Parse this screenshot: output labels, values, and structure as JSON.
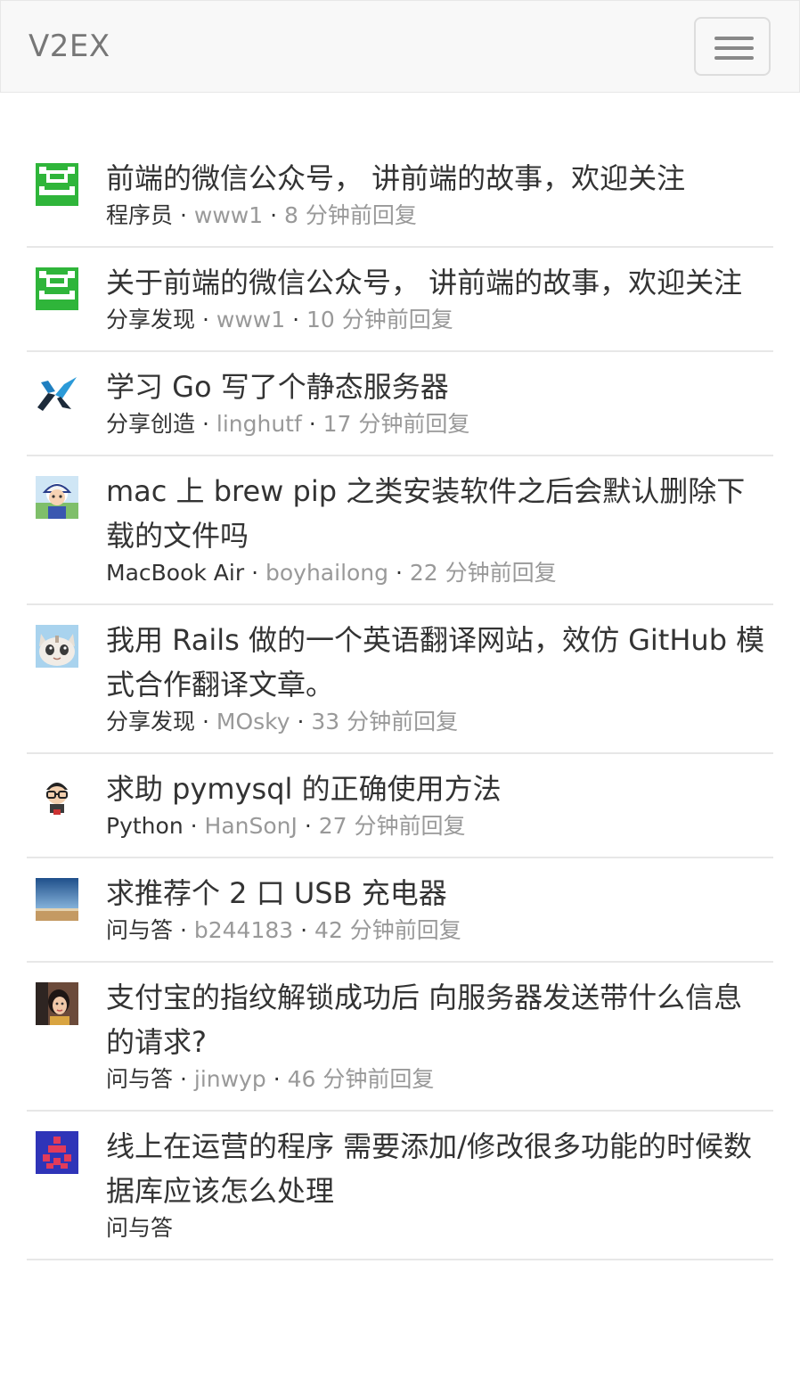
{
  "navbar": {
    "brand": "V2EX",
    "toggle_icon": "hamburger-menu-icon"
  },
  "topics": [
    {
      "title": "前端的微信公众号， 讲前端的故事，欢迎关注",
      "node": "程序员",
      "user": "www1",
      "time": "8 分钟前回复",
      "avatar_icon": "green-pixel-avatar-icon"
    },
    {
      "title": "关于前端的微信公众号， 讲前端的故事，欢迎关注",
      "node": "分享发现",
      "user": "www1",
      "time": "10 分钟前回复",
      "avatar_icon": "green-pixel-avatar-icon"
    },
    {
      "title": "学习 Go 写了个静态服务器",
      "node": "分享创造",
      "user": "linghutf",
      "time": "17 分钟前回复",
      "avatar_icon": "blue-x-logo-avatar-icon"
    },
    {
      "title": "mac 上 brew pip 之类安装软件之后会默认删除下载的文件吗",
      "node": "MacBook Air",
      "user": "boyhailong",
      "time": "22 分钟前回复",
      "avatar_icon": "cartoon-person-avatar-icon"
    },
    {
      "title": "我用 Rails 做的一个英语翻译网站，效仿 GitHub 模式合作翻译文章。",
      "node": "分享发现",
      "user": "MOsky",
      "time": "33 分钟前回复",
      "avatar_icon": "cat-avatar-icon"
    },
    {
      "title": "求助 pymysql 的正确使用方法",
      "node": "Python",
      "user": "HanSonJ",
      "time": "27 分钟前回复",
      "avatar_icon": "glasses-character-avatar-icon"
    },
    {
      "title": "求推荐个 2 口 USB 充电器",
      "node": "问与答",
      "user": "b244183",
      "time": "42 分钟前回复",
      "avatar_icon": "landscape-photo-avatar-icon"
    },
    {
      "title": "支付宝的指纹解锁成功后 向服务器发送带什么信息的请求?",
      "node": "问与答",
      "user": "jinwyp",
      "time": "46 分钟前回复",
      "avatar_icon": "person-photo-avatar-icon"
    },
    {
      "title": "线上在运营的程序 需要添加/修改很多功能的时候数据库应该怎么处理",
      "node": "问与答",
      "user": "",
      "time": "",
      "avatar_icon": "blue-pixel-avatar-icon"
    }
  ],
  "separator": "·"
}
